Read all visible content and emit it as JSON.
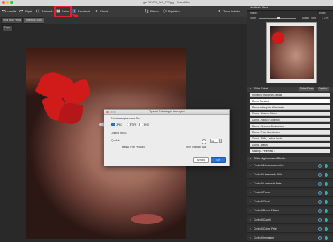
{
  "window": {
    "title": "girl-783678_960_720.jpg - PortraitPro"
  },
  "toolbar": {
    "undo": "Annulla",
    "redo": "Ripeti",
    "other_views": "Altri vedi",
    "save": "Salva",
    "facebook": "Facebook",
    "close": "Chiudi",
    "crop": "Ritocca",
    "rotate": "Ripristina",
    "back": "Torna indietro"
  },
  "view_tabs": {
    "before": "Vedi solo Prima",
    "after": "Vedi solo Dopo",
    "label": "Dopo"
  },
  "dialog": {
    "title": "Opzioni Salvataggio Immagine",
    "save_as_label": "Salva immagine come Tipo",
    "formats": [
      "JPEG",
      "TIFF",
      "PNG"
    ],
    "selected_format": "JPEG",
    "jpeg_options_label": "Opzioni JPEG",
    "quality_label": "Qualità:",
    "quality_value": "94",
    "quality_fraction": 0.94,
    "low_label": "Bassa (File Piccolo)",
    "high_label": "(File Grande) Alta",
    "cancel": "Annulla",
    "ok": "OK"
  },
  "navigator": {
    "title": "Modifica la Vista",
    "before": "Indietro",
    "after": "Avanti",
    "zoom_label": "Zoom",
    "fit_label": "Adatta",
    "actual_label": "Vedi",
    "zoom_value": "1:33%"
  },
  "presets": {
    "title": "Slider Salvati",
    "save_btn": "Salva Slider",
    "manage_btn": "Gestisci",
    "items": [
      "Ripristina Immagine Originale",
      "Donna Standard",
      "Donna dall'aspetto Affascinante",
      "Donna - Nessun Ritocco",
      "Donna - Ritocco Contenuto",
      "Donna - Nessuna Illuminazione",
      "Donna - Poca Illuminazione",
      "Donna - Pelle, Labbra, Occhi",
      "Donna - Matura",
      "Makeup - Pennellate 1"
    ],
    "selected_index": 1
  },
  "adjustments": {
    "title": "Slider Miglioramento Ritratto",
    "items": [
      "Controlli Modellamento Viso",
      "Controlli Lineamento Pelle",
      "Controlli Luminosità Pelle",
      "Controlli Trucco",
      "Controlli Occhi",
      "Controlli Bocca & Naso",
      "Controlli Capelli",
      "Controlli Colore Pelle",
      "Controlli Immagine"
    ]
  },
  "colors": {
    "accent": "#2b74d8",
    "highlight": "#e3232a",
    "teal": "#2fb3a8"
  }
}
